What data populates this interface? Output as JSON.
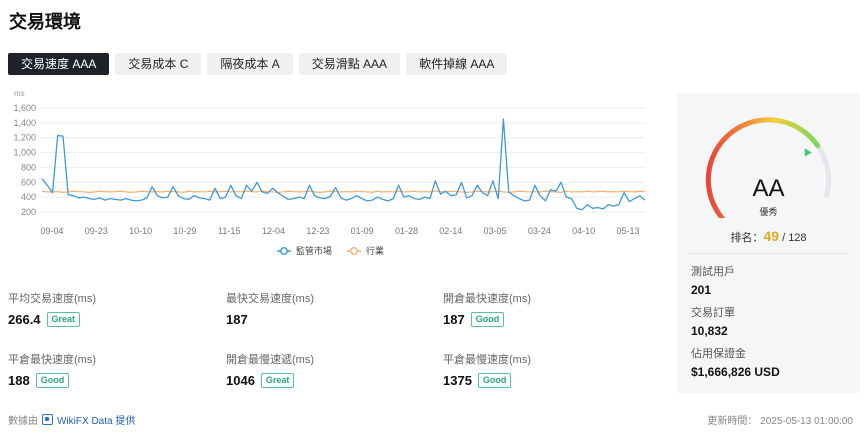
{
  "page_title": "交易環境",
  "tabs": [
    "交易速度 AAA",
    "交易成本 C",
    "隔夜成本 A",
    "交易滑點 AAA",
    "軟件掉線 AAA"
  ],
  "chart_data": {
    "type": "line",
    "ylabel": "ms",
    "ylim": [
      200,
      1600
    ],
    "yticks": [
      200,
      400,
      600,
      800,
      1000,
      1200,
      1400,
      1600
    ],
    "categories": [
      "09-04",
      "09-23",
      "10-10",
      "10-29",
      "11-15",
      "12-04",
      "12-23",
      "01-09",
      "01-28",
      "02-14",
      "03-05",
      "03-24",
      "04-10",
      "05-13"
    ],
    "grid": true,
    "legend_position": "bottom",
    "series": [
      {
        "name": "監管市場",
        "color": "#3d9ad6",
        "values": [
          650,
          560,
          460,
          1230,
          1220,
          430,
          420,
          390,
          400,
          380,
          370,
          390,
          360,
          380,
          370,
          360,
          380,
          360,
          350,
          360,
          390,
          540,
          420,
          390,
          400,
          540,
          420,
          380,
          370,
          420,
          390,
          380,
          360,
          520,
          380,
          400,
          560,
          420,
          380,
          560,
          480,
          600,
          470,
          450,
          520,
          460,
          410,
          370,
          380,
          400,
          380,
          560,
          420,
          390,
          380,
          410,
          530,
          390,
          360,
          380,
          420,
          380,
          350,
          360,
          400,
          370,
          350,
          380,
          560,
          400,
          420,
          380,
          370,
          400,
          380,
          620,
          440,
          480,
          420,
          430,
          600,
          390,
          420,
          560,
          460,
          420,
          620,
          380,
          1450,
          470,
          420,
          380,
          350,
          360,
          560,
          420,
          350,
          500,
          480,
          600,
          400,
          380,
          250,
          230,
          300,
          250,
          260,
          240,
          300,
          280,
          300,
          460,
          340,
          380,
          420,
          360
        ]
      },
      {
        "name": "行業",
        "color": "#f2b37b",
        "values": [
          480,
          470,
          470,
          475,
          465,
          470,
          480,
          475,
          470,
          465,
          470,
          480,
          475,
          470,
          475,
          480,
          470,
          465,
          470,
          480,
          475,
          470,
          475,
          470,
          480,
          475,
          470,
          465,
          480,
          470,
          475,
          470,
          480,
          470,
          475,
          480,
          470,
          475,
          470,
          480,
          475,
          470,
          480,
          475,
          470,
          465,
          470,
          480,
          475,
          470,
          475,
          480,
          470,
          465,
          470,
          480,
          475,
          470,
          475,
          470,
          480,
          475,
          470,
          465,
          480,
          470,
          475,
          470,
          480,
          470,
          475,
          480,
          470,
          475,
          470,
          480,
          475,
          470,
          480,
          475,
          470,
          465,
          470,
          480,
          475,
          470,
          475,
          480,
          470,
          465,
          470,
          480,
          475,
          470,
          475,
          470,
          480,
          475,
          470,
          465,
          480,
          470,
          475,
          470,
          480,
          470,
          475,
          480,
          470,
          475,
          470,
          480,
          475,
          470,
          480,
          475
        ]
      }
    ]
  },
  "metrics": [
    {
      "label": "平均交易速度(ms)",
      "value": "266.4",
      "badge": "Great"
    },
    {
      "label": "最快交易速度(ms)",
      "value": "187",
      "badge": ""
    },
    {
      "label": "開倉最快速度(ms)",
      "value": "187",
      "badge": "Good"
    },
    {
      "label": "平倉最快速度(ms)",
      "value": "188",
      "badge": "Good"
    },
    {
      "label": "開倉最慢速遞(ms)",
      "value": "1046",
      "badge": "Great"
    },
    {
      "label": "平倉最慢速度(ms)",
      "value": "1375",
      "badge": "Good"
    }
  ],
  "side": {
    "grade": "AA",
    "grade_label": "優秀",
    "rank_label": "排名：",
    "rank_value": "49",
    "rank_total": "/ 128",
    "gauge_level": 0.8,
    "stats": [
      {
        "label": "測試用戶",
        "value": "201"
      },
      {
        "label": "交易訂單",
        "value": "10,832"
      },
      {
        "label": "佔用保證金",
        "value": "$1,666,826 USD"
      }
    ]
  },
  "footer": {
    "source_prefix": "數據由",
    "brand": "WikiFX Data 提供",
    "updated": "更新時間： 2025-05-13 01:00:00"
  }
}
